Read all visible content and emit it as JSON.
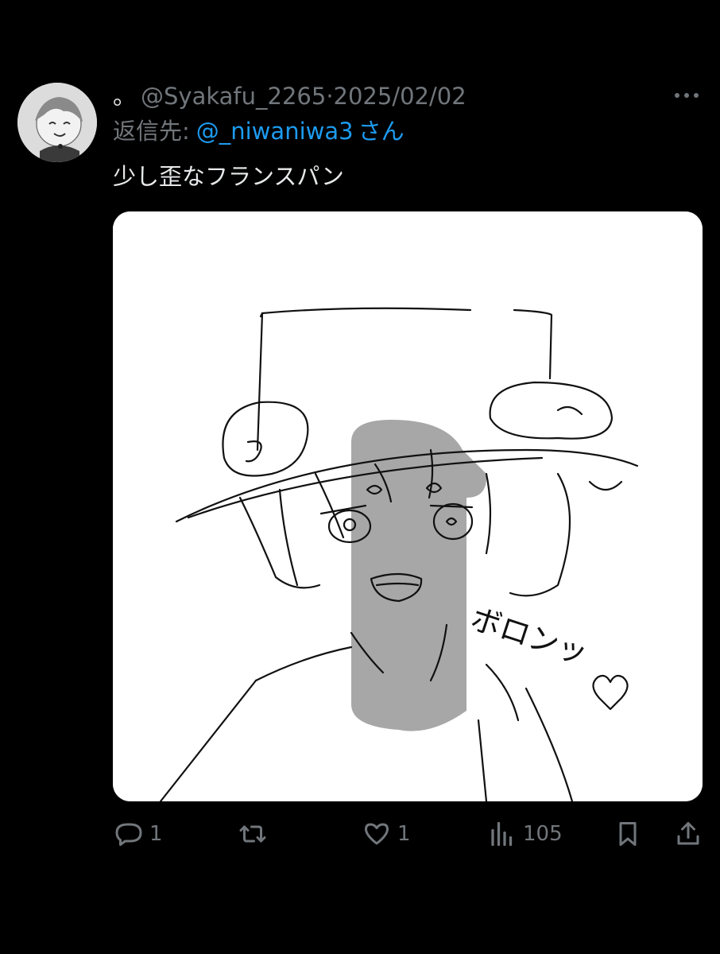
{
  "tweet": {
    "display_name": "。",
    "handle": "@Syakafu_2265",
    "separator": "·",
    "date": "2025/02/02",
    "reply_prefix": "返信先:",
    "reply_to": "@_niwaniwa3",
    "reply_suffix": "さん",
    "text": "少し歪なフランスパン",
    "drawing_text": "ボロンッ"
  },
  "actions": {
    "reply_count": "1",
    "retweet_count": "",
    "like_count": "1",
    "views_count": "105"
  },
  "colors": {
    "background": "#000000",
    "primary_text": "#e7e9ea",
    "secondary_text": "#71767b",
    "link": "#1d9bf0"
  },
  "icons": [
    "avatar",
    "more-dots-icon",
    "reply-icon",
    "retweet-icon",
    "like-icon",
    "views-icon",
    "bookmark-icon",
    "share-icon"
  ]
}
